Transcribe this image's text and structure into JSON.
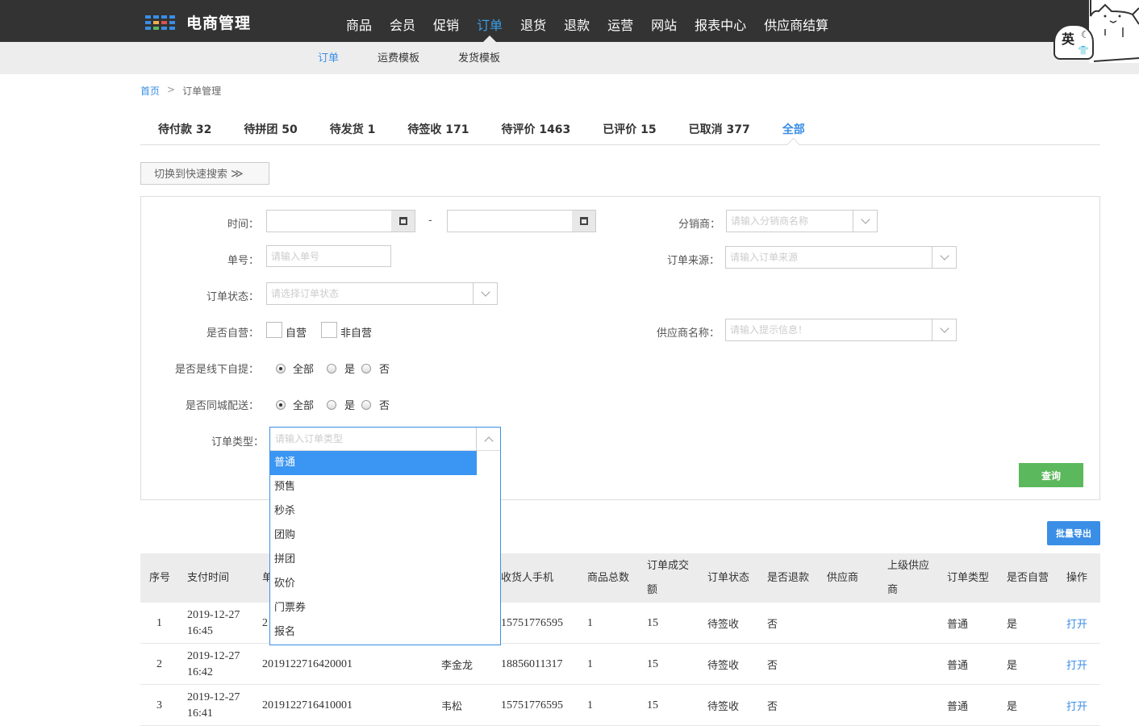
{
  "app": {
    "title": "电商管理"
  },
  "nav": {
    "items": [
      "商品",
      "会员",
      "促销",
      "订单",
      "退货",
      "退款",
      "运营",
      "网站",
      "报表中心",
      "供应商结算"
    ],
    "active_index": 3
  },
  "subnav": {
    "items": [
      "订单",
      "运费模板",
      "发货模板"
    ],
    "active_index": 0
  },
  "ime": {
    "char": "英"
  },
  "breadcrumb": {
    "home": "首页",
    "sep": ">",
    "current": "订单管理"
  },
  "tabs": [
    "待付款 32",
    "待拼团 50",
    "待发货 1",
    "待签收 171",
    "待评价 1463",
    "已评价 15",
    "已取消 377",
    "全部"
  ],
  "quick_search": {
    "label": "切换到快速搜索"
  },
  "filters": {
    "time_label": "时间：",
    "dash": "-",
    "distributor_label": "分销商：",
    "distributor_placeholder": "请输入分销商名称",
    "order_no_label": "单号：",
    "order_no_placeholder": "请输入单号",
    "source_label": "订单来源：",
    "source_placeholder": "请输入订单来源",
    "status_label": "订单状态：",
    "status_placeholder": "请选择订单状态",
    "self_run_label": "是否自营：",
    "self_run_opt1": "自营",
    "self_run_opt2": "非自营",
    "supplier_label": "供应商名称：",
    "supplier_placeholder": "请输入提示信息！",
    "pickup_label": "是否是线下自提：",
    "local_label": "是否同城配送：",
    "radio_all": "全部",
    "radio_yes": "是",
    "radio_no": "否",
    "type_label": "订单类型：",
    "type_placeholder": "请输入订单类型",
    "query_btn": "查询"
  },
  "dropdown": {
    "options": [
      "普通",
      "预售",
      "秒杀",
      "团购",
      "拼团",
      "砍价",
      "门票券",
      "报名"
    ],
    "selected_index": 0
  },
  "export_btn": "批量导出",
  "table": {
    "headers": [
      "序号",
      "支付时间",
      "单",
      "收货人手机",
      "商品总数",
      "订单成交额",
      "订单状态",
      "是否退款",
      "供应商",
      "上级供应商",
      "订单类型",
      "是否自营",
      "操作"
    ],
    "rows": [
      {
        "no": "1",
        "pay_date": "2019-12-27",
        "pay_time": "16:45",
        "order_no": "2",
        "receiver": "",
        "phone": "15751776595",
        "qty": "1",
        "amount": "15",
        "status": "待签收",
        "refund": "否",
        "supplier": "",
        "parent_supplier": "",
        "type": "普通",
        "self_run": "是",
        "action": "打开"
      },
      {
        "no": "2",
        "pay_date": "2019-12-27",
        "pay_time": "16:42",
        "order_no": "2019122716420001",
        "receiver": "李金龙",
        "phone": "18856011317",
        "qty": "1",
        "amount": "15",
        "status": "待签收",
        "refund": "否",
        "supplier": "",
        "parent_supplier": "",
        "type": "普通",
        "self_run": "是",
        "action": "打开"
      },
      {
        "no": "3",
        "pay_date": "2019-12-27",
        "pay_time": "16:41",
        "order_no": "2019122716410001",
        "receiver": "韦松",
        "phone": "15751776595",
        "qty": "1",
        "amount": "15",
        "status": "待签收",
        "refund": "否",
        "supplier": "",
        "parent_supplier": "",
        "type": "普通",
        "self_run": "是",
        "action": "打开"
      }
    ]
  },
  "colors": {
    "accent": "#3a8ee6",
    "topbar": "#333333",
    "query": "#5cb85c"
  }
}
